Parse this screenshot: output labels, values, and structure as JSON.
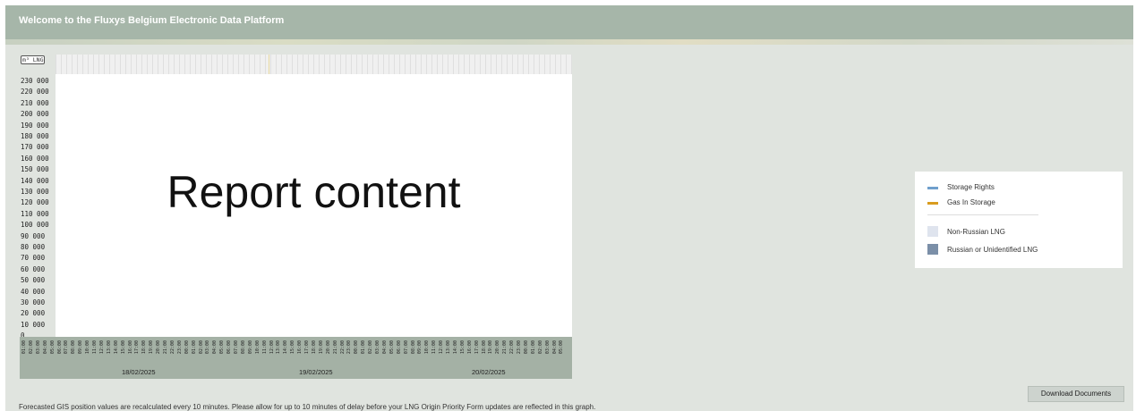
{
  "header": {
    "title": "Welcome to the Fluxys Belgium Electronic Data Platform"
  },
  "chart": {
    "unit": "m³ LNG",
    "y_ticks": [
      "230 000",
      "220 000",
      "210 000",
      "200 000",
      "190 000",
      "180 000",
      "170 000",
      "160 000",
      "150 000",
      "140 000",
      "130 000",
      "120 000",
      "110 000",
      "100 000",
      "90 000",
      "80 000",
      "70 000",
      "60 000",
      "50 000",
      "40 000",
      "30 000",
      "20 000",
      "10 000",
      "0"
    ],
    "x_ticks": [
      "01:00",
      "02:00",
      "03:00",
      "04:00",
      "05:00",
      "06:00",
      "07:00",
      "08:00",
      "09:00",
      "10:00",
      "11:00",
      "12:00",
      "13:00",
      "14:00",
      "15:00",
      "16:00",
      "17:00",
      "18:00",
      "19:00",
      "20:00",
      "21:00",
      "22:00",
      "23:00",
      "00:00",
      "01:00",
      "02:00",
      "03:00",
      "04:00",
      "05:00",
      "06:00",
      "07:00",
      "08:00",
      "09:00",
      "10:00",
      "11:00",
      "12:00",
      "13:00",
      "14:00",
      "15:00",
      "16:00",
      "17:00",
      "18:00",
      "19:00",
      "20:00",
      "21:00",
      "22:00",
      "23:00",
      "00:00",
      "01:00",
      "02:00",
      "03:00",
      "04:00",
      "05:00",
      "06:00",
      "07:00",
      "08:00",
      "09:00",
      "10:00",
      "11:00",
      "12:00",
      "13:00",
      "14:00",
      "15:00",
      "16:00",
      "17:00",
      "18:00",
      "19:00",
      "20:00",
      "21:00",
      "22:00",
      "23:00",
      "00:00",
      "01:00",
      "02:00",
      "03:00",
      "04:00",
      "05:00"
    ],
    "dates": [
      "18/02/2025",
      "19/02/2025",
      "20/02/2025"
    ],
    "content_text": "Report content"
  },
  "legend": {
    "items": [
      {
        "label": "Storage Rights",
        "color": "#6f9fcc",
        "kind": "line"
      },
      {
        "label": "Gas In Storage",
        "color": "#d99c1f",
        "kind": "line"
      },
      {
        "label": "Non-Russian LNG",
        "color": "#dfe4ee",
        "kind": "box"
      },
      {
        "label": "Russian or Unidentified LNG",
        "color": "#7b8fa8",
        "kind": "box"
      }
    ]
  },
  "actions": {
    "download_label": "Download Documents"
  },
  "footnote": "Forecasted GIS position values are recalculated every 10 minutes. Please allow for up to 10 minutes of delay before your LNG Origin Priority Form updates are reflected in this graph."
}
